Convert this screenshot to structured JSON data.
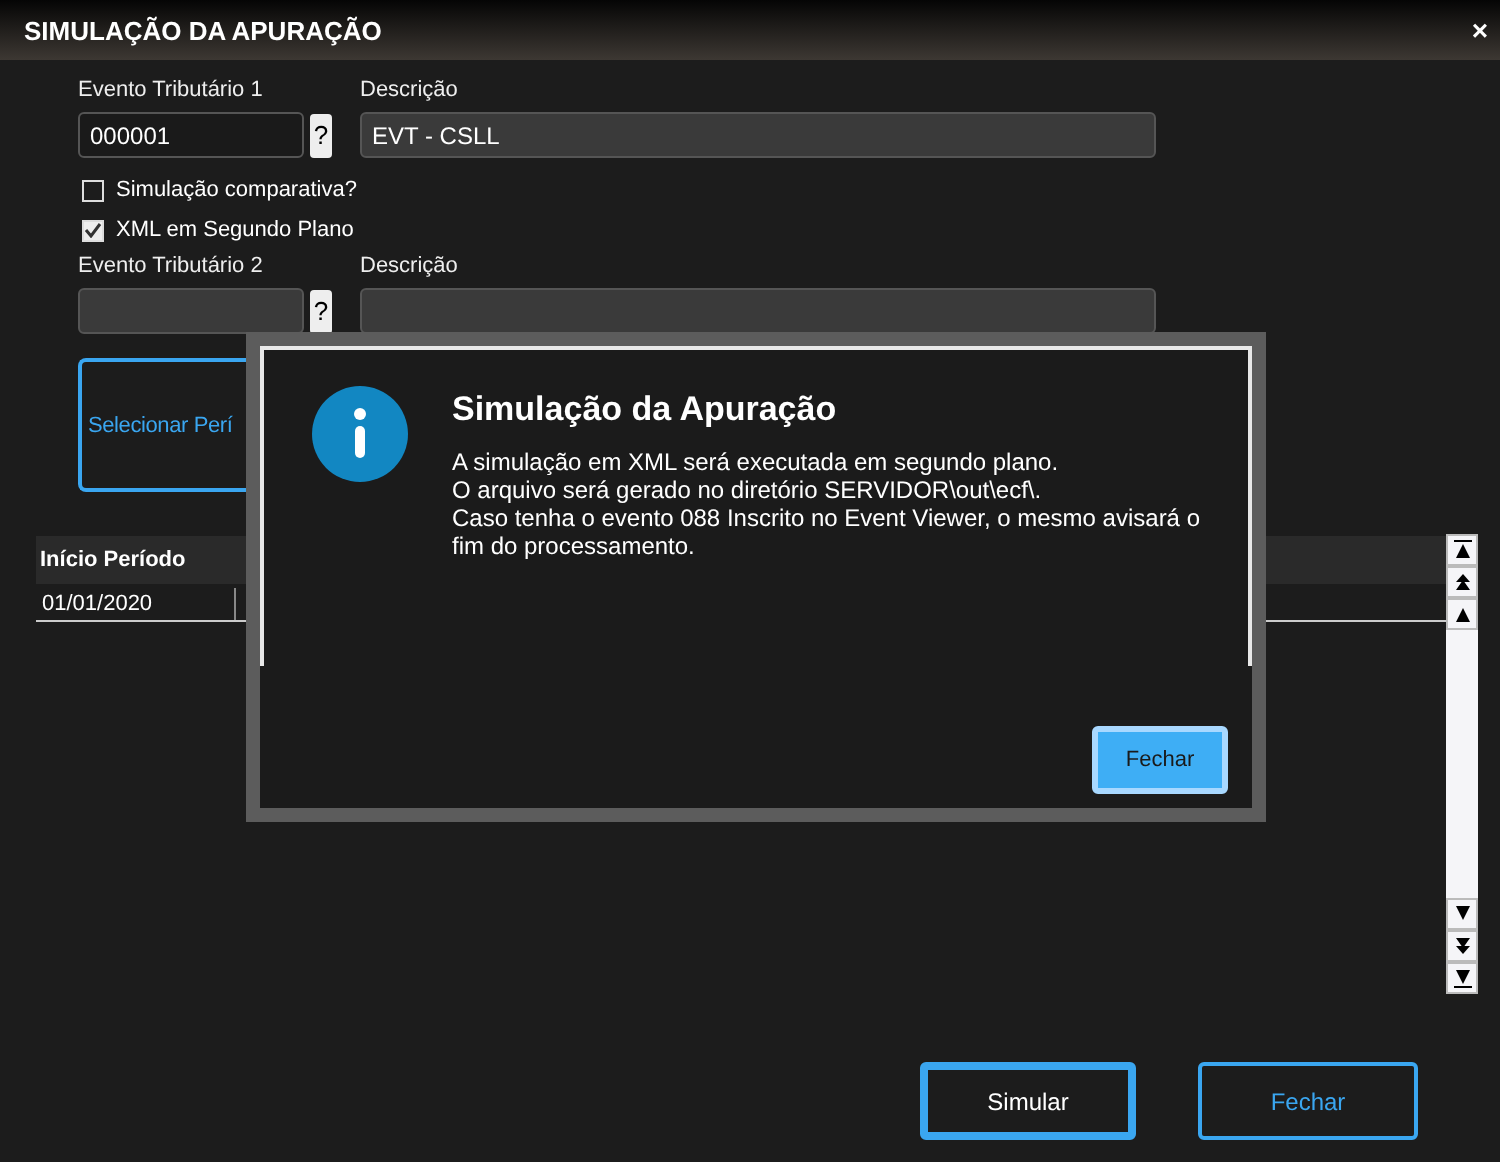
{
  "window": {
    "title": "SIMULAÇÃO DA APURAÇÃO",
    "close": "×"
  },
  "event1": {
    "label": "Evento Tributário 1",
    "value": "000001",
    "help": "?",
    "description_label": "Descrição",
    "description": "EVT - CSLL"
  },
  "options": [
    {
      "label": "Simulação comparativa?",
      "checked": false
    },
    {
      "label": "XML em Segundo Plano",
      "checked": true
    }
  ],
  "event2": {
    "label": "Evento Tributário 2",
    "help": "?",
    "description_label": "Descrição"
  },
  "select_period_button": "Selecionar Perí",
  "table": {
    "columns": [
      "Início Período"
    ],
    "rows": [
      [
        "01/01/2020"
      ]
    ]
  },
  "dialog": {
    "title": "Simulação da Apuração",
    "lines": [
      "A simulação em XML será executada em segundo plano.",
      "O arquivo será gerado no diretório SERVIDOR\\out\\ecf\\.",
      "Caso tenha o evento 088 Inscrito no Event Viewer, o mesmo avisará o fim do processamento."
    ],
    "button": "Fechar"
  },
  "buttons": [
    "Simular",
    "Fechar"
  ]
}
